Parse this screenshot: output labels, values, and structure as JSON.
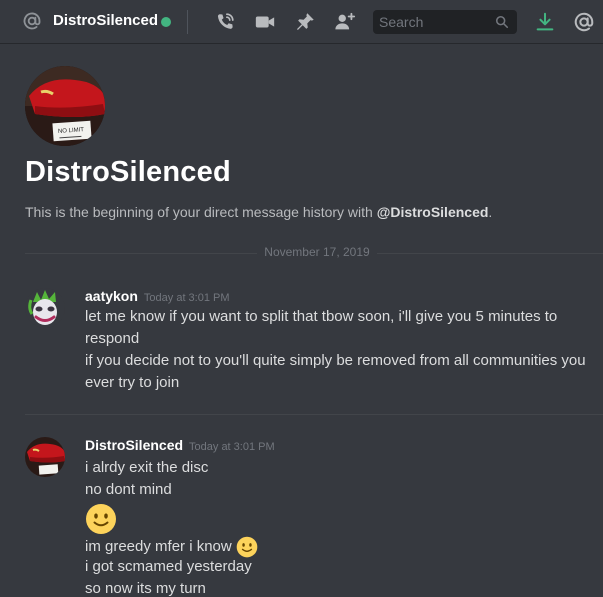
{
  "header": {
    "channel_name": "DistroSilenced",
    "search_placeholder": "Search",
    "icons": [
      "at-icon",
      "phone-call-icon",
      "video-call-icon",
      "pin-icon",
      "add-friend-icon",
      "search-icon",
      "download-icon",
      "mention-icon"
    ],
    "status_color": "#43b581",
    "accent_download": "#43b581"
  },
  "intro": {
    "name": "DistroSilenced",
    "desc_prefix": "This is the beginning of your direct message history with ",
    "desc_handle": "@DistroSilenced",
    "desc_suffix": ".",
    "avatar_sign_text": "NO LIMIT"
  },
  "date_divider": "November 17, 2019",
  "messages": [
    {
      "author": "aatykon",
      "timestamp": "Today at 3:01 PM",
      "lines": [
        "let me know if you want to split that tbow soon, i'll give you 5 minutes to",
        "respond",
        "if you decide not to you'll quite simply be removed from all communities you",
        "ever try to join"
      ]
    },
    {
      "author": "DistroSilenced",
      "timestamp": "Today at 3:01 PM",
      "lines": [
        "i alrdy exit the disc",
        "no dont mind",
        "im greedy mfer i know",
        "i got scmamed yesterday",
        "so now its my turn"
      ]
    }
  ],
  "colors": {
    "background": "#36393f",
    "text": "#dcddde",
    "muted": "#72767d",
    "emoji": "#fdd35b"
  }
}
